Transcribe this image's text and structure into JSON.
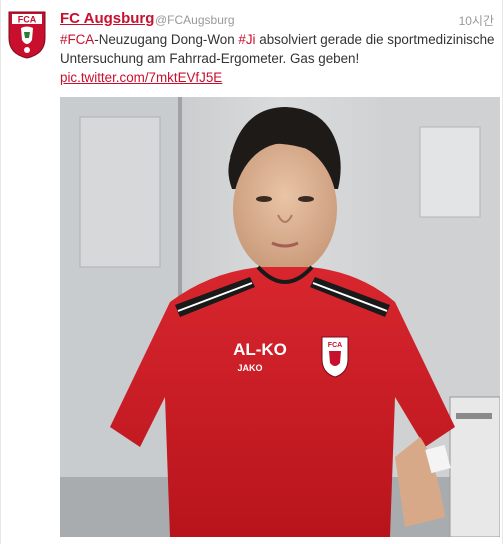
{
  "tweet": {
    "author_name": "FC Augsburg",
    "author_handle": "@FCAugsburg",
    "timestamp": "10시간",
    "avatar_text": "FCA",
    "text": {
      "hashtag_fca": "#FCA",
      "part1": "-Neuzugang Dong-Won ",
      "hashtag_ji": "#Ji",
      "part2": " absolviert gerade die sportmedizinische Untersuchung am Fahrrad-Ergometer. Gas geben!",
      "link": "pic.twitter.com/7mktEVfJ5E"
    },
    "photo": {
      "shirt_sponsor": "AL-KO",
      "shirt_brand": "JAKO",
      "badge_text": "FCA"
    }
  },
  "colors": {
    "brand_red": "#c8102e",
    "text": "#333333",
    "muted": "#999999"
  }
}
